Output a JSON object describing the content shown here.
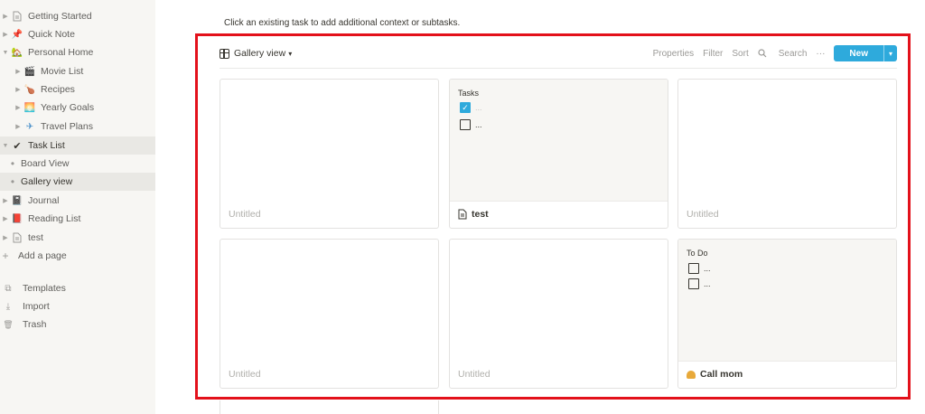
{
  "sidebar": {
    "items": [
      {
        "label": "Getting Started",
        "icon": "page-icon",
        "glyph": "🗋",
        "kind": "page"
      },
      {
        "label": "Quick Note",
        "icon": "pushpin-icon",
        "glyph": "📌",
        "kind": "page"
      },
      {
        "label": "Personal Home",
        "icon": "house-icon",
        "glyph": "🏡",
        "kind": "page-open"
      },
      {
        "label": "Movie List",
        "icon": "clapper-icon",
        "glyph": "🎬",
        "kind": "child"
      },
      {
        "label": "Recipes",
        "icon": "drumstick-icon",
        "glyph": "🍗",
        "kind": "child"
      },
      {
        "label": "Yearly Goals",
        "icon": "sunrise-icon",
        "glyph": "🌅",
        "kind": "child"
      },
      {
        "label": "Travel Plans",
        "icon": "airplane-icon",
        "glyph": "✈",
        "kind": "child"
      },
      {
        "label": "Task List",
        "icon": "checkmark-icon",
        "glyph": "✔",
        "kind": "page-open-active"
      },
      {
        "label": "Board View",
        "icon": "bullet-icon",
        "glyph": "•",
        "kind": "view"
      },
      {
        "label": "Gallery view",
        "icon": "bullet-icon",
        "glyph": "•",
        "kind": "view-active"
      },
      {
        "label": "Journal",
        "icon": "notebook-icon",
        "glyph": "📓",
        "kind": "page"
      },
      {
        "label": "Reading List",
        "icon": "book-icon",
        "glyph": "📕",
        "kind": "page"
      },
      {
        "label": "test",
        "icon": "page-icon",
        "glyph": "🗋",
        "kind": "page"
      }
    ],
    "add_page": "Add a page",
    "footer": [
      {
        "label": "Templates",
        "icon": "templates-icon",
        "glyph": "⧉"
      },
      {
        "label": "Import",
        "icon": "import-icon",
        "glyph": "⤓"
      },
      {
        "label": "Trash",
        "icon": "trash-icon",
        "glyph": "🗑"
      }
    ]
  },
  "main": {
    "hint": "Click an existing task to add additional context or subtasks.",
    "toolbar": {
      "view_label": "Gallery view",
      "properties": "Properties",
      "filter": "Filter",
      "sort": "Sort",
      "search": "Search",
      "more": "···",
      "new": "New"
    },
    "cards": [
      {
        "title": "Untitled",
        "named": false
      },
      {
        "title": "test",
        "named": true,
        "title_icon": "page-icon",
        "preview_head": "Tasks",
        "todos": [
          {
            "text": "...",
            "checked": true
          },
          {
            "text": "...",
            "checked": false
          }
        ]
      },
      {
        "title": "Untitled",
        "named": false
      },
      {
        "title": "Untitled",
        "named": false
      },
      {
        "title": "Untitled",
        "named": false
      },
      {
        "title": "Call mom",
        "named": true,
        "title_icon": "telephone-icon",
        "preview_head": "To Do",
        "todos": [
          {
            "text": "...",
            "checked": false
          },
          {
            "text": "...",
            "checked": false
          }
        ]
      }
    ]
  },
  "colors": {
    "accent": "#2eaadc",
    "highlight_frame": "#e3111b",
    "sidebar_bg": "#f7f6f3"
  }
}
